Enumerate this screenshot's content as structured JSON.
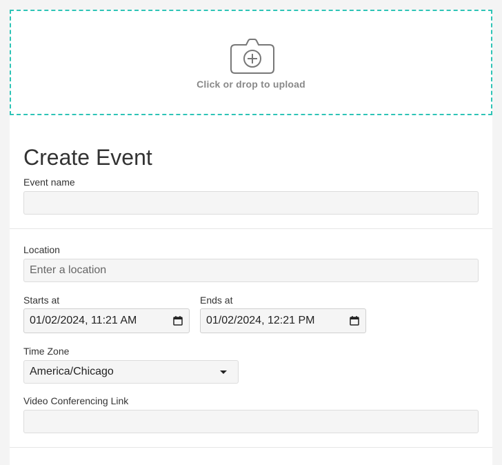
{
  "upload": {
    "label": "Click or drop to upload",
    "icon": "camera-plus-icon",
    "border_color": "#2ec4b6"
  },
  "form": {
    "title": "Create Event",
    "event_name": {
      "label": "Event name",
      "value": ""
    },
    "location": {
      "label": "Location",
      "placeholder": "Enter a location",
      "value": ""
    },
    "starts_at": {
      "label": "Starts at",
      "value": "01/02/2024, 11:21 AM"
    },
    "ends_at": {
      "label": "Ends at",
      "value": "01/02/2024, 12:21 PM"
    },
    "time_zone": {
      "label": "Time Zone",
      "value": "America/Chicago"
    },
    "video_link": {
      "label": "Video Conferencing Link",
      "value": ""
    }
  }
}
